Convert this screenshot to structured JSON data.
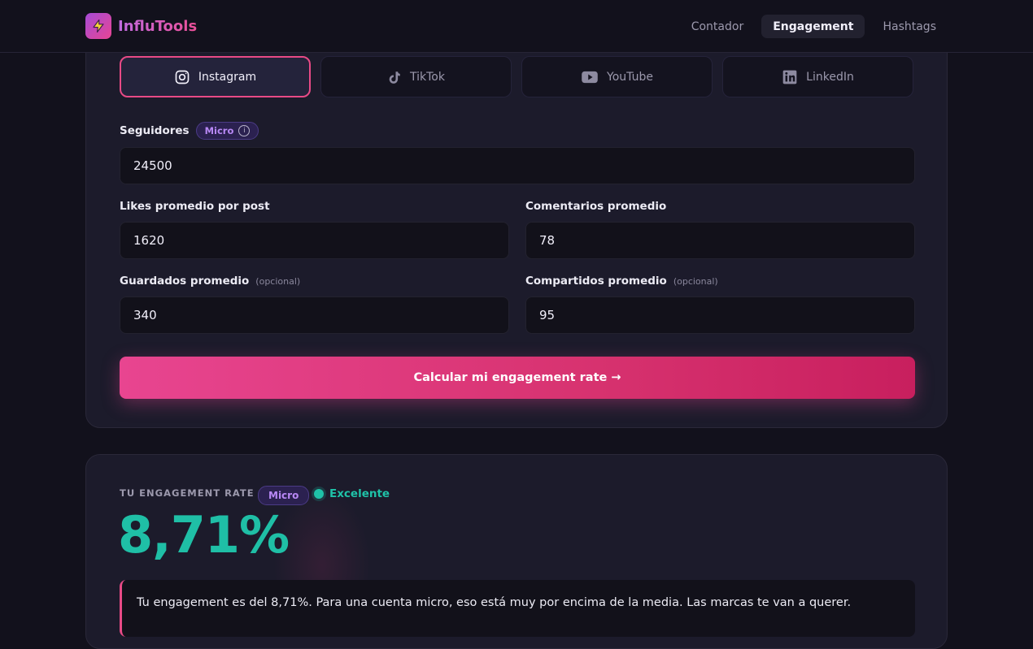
{
  "header": {
    "brand": "InfluTools",
    "nav": [
      {
        "label": "Contador",
        "active": false
      },
      {
        "label": "Engagement",
        "active": true
      },
      {
        "label": "Hashtags",
        "active": false
      }
    ]
  },
  "platforms": [
    {
      "label": "Instagram",
      "icon": "instagram-icon",
      "active": true
    },
    {
      "label": "TikTok",
      "icon": "tiktok-icon",
      "active": false
    },
    {
      "label": "YouTube",
      "icon": "youtube-icon",
      "active": false
    },
    {
      "label": "LinkedIn",
      "icon": "linkedin-icon",
      "active": false
    }
  ],
  "form": {
    "followers": {
      "label": "Seguidores",
      "badge": "Micro",
      "info": "i",
      "value": "24500"
    },
    "likes": {
      "label": "Likes promedio por post",
      "value": "1620"
    },
    "comments": {
      "label": "Comentarios promedio",
      "value": "78"
    },
    "saves": {
      "label": "Guardados promedio",
      "optional": "(opcional)",
      "value": "340"
    },
    "shares": {
      "label": "Compartidos promedio",
      "optional": "(opcional)",
      "value": "95"
    },
    "submit_label": "Calcular mi engagement rate →"
  },
  "result": {
    "label": "TU ENGAGEMENT RATE",
    "badge": "Micro",
    "status": "Excelente",
    "value": "8,71%",
    "message": "Tu engagement es del 8,71%. Para una cuenta micro, eso está muy por encima de la media. Las marcas te van a querer."
  },
  "colors": {
    "accent_pink": "#e84a86",
    "accent_teal": "#1fbfa6",
    "badge_purple": "#b888f5",
    "background": "#12111c",
    "card": "#1c1b2b"
  }
}
